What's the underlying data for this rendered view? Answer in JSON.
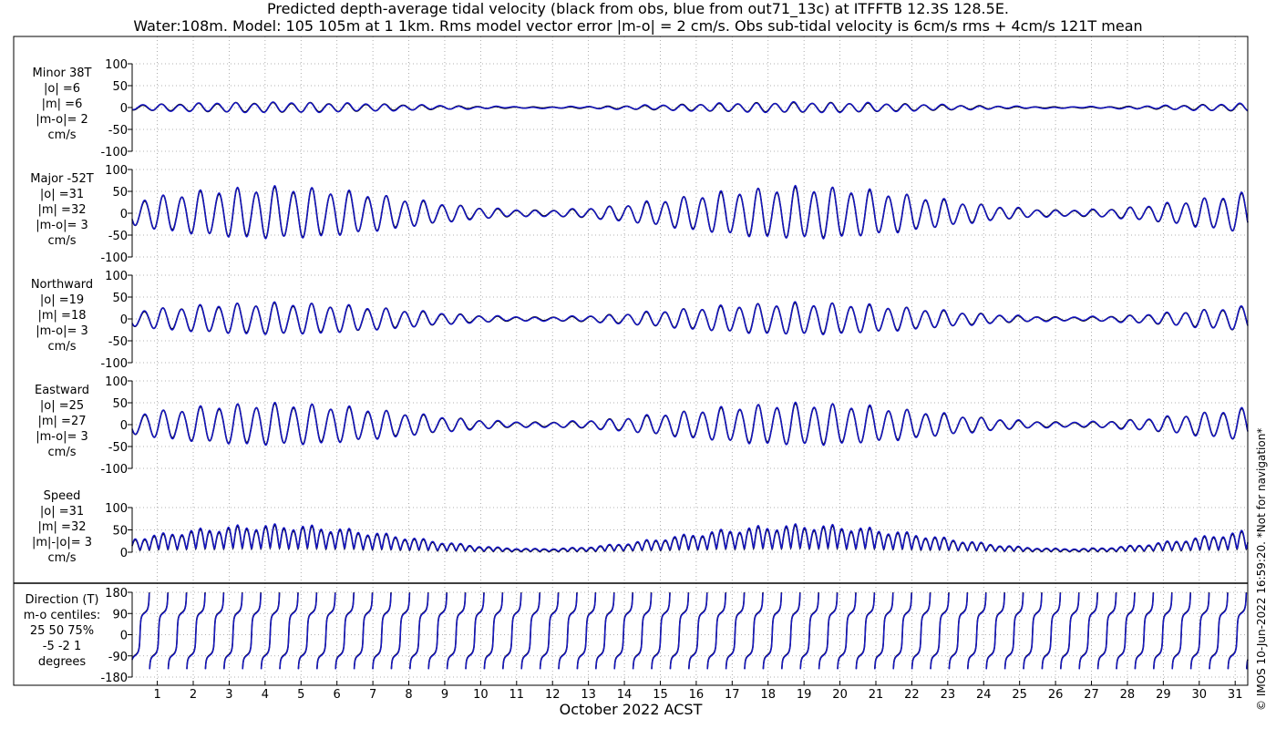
{
  "title": {
    "line1": "Predicted depth-average tidal velocity (black from obs, blue from out71_13c) at ITFFTB 12.3S 128.5E.",
    "line2": "Water:108m. Model: 105 105m at 1 1km. Rms model vector error |m-o| = 2 cm/s. Obs sub-tidal velocity is 6cm/s rms + 4cm/s 121T mean"
  },
  "credit": "© IMOS 10-Jun-2022 16:59:20. *Not for navigation*",
  "xlabel": "October 2022 ACST",
  "colors": {
    "obs": "#000000",
    "model": "#1414c8",
    "grid": "#999999",
    "frame": "#000000"
  },
  "chart_data": {
    "type": "line",
    "x": {
      "label": "October 2022 ACST",
      "ticks": [
        "1",
        "2",
        "3",
        "4",
        "5",
        "6",
        "7",
        "8",
        "9",
        "10",
        "11",
        "12",
        "13",
        "14",
        "15",
        "16",
        "17",
        "18",
        "19",
        "20",
        "21",
        "22",
        "23",
        "24",
        "25",
        "26",
        "27",
        "28",
        "29",
        "30",
        "31"
      ],
      "range_days": [
        0.3,
        31.35
      ]
    },
    "series_legend": [
      "black from obs",
      "blue from out71_13c"
    ],
    "panels": [
      {
        "id": "minor",
        "label": [
          "Minor 38T",
          "|o| =6",
          "|m| =6",
          "|m-o|= 2",
          "cm/s"
        ],
        "ylim": [
          -100,
          100
        ],
        "yticks": [
          100,
          50,
          0,
          -50,
          -100
        ],
        "ytick_labels": [
          "100",
          "50",
          "0",
          "-50",
          "-100"
        ],
        "kind": "component",
        "amp": 6,
        "phase": 0.6
      },
      {
        "id": "major",
        "label": [
          "Major -52T",
          "|o| =31",
          "|m| =32",
          "|m-o|= 3",
          "cm/s"
        ],
        "ylim": [
          -100,
          100
        ],
        "yticks": [
          100,
          50,
          0,
          -50,
          -100
        ],
        "ytick_labels": [
          "100",
          "50",
          "0",
          "-50",
          "-100"
        ],
        "kind": "component",
        "amp": 31,
        "phase": 0
      },
      {
        "id": "northward",
        "label": [
          "Northward",
          "|o| =19",
          "|m| =18",
          "|m-o|= 3",
          "cm/s"
        ],
        "ylim": [
          -100,
          100
        ],
        "yticks": [
          100,
          50,
          0,
          -50,
          -100
        ],
        "ytick_labels": [
          "100",
          "50",
          "0",
          "-50",
          "-100"
        ],
        "kind": "component",
        "amp": 19,
        "phase": 0.1
      },
      {
        "id": "eastward",
        "label": [
          "Eastward",
          "|o| =25",
          "|m| =27",
          "|m-o|= 3",
          "cm/s"
        ],
        "ylim": [
          -100,
          100
        ],
        "yticks": [
          100,
          50,
          0,
          -50,
          -100
        ],
        "ytick_labels": [
          "100",
          "50",
          "0",
          "-50",
          "-100"
        ],
        "kind": "component",
        "amp": 25,
        "phase": -0.05
      },
      {
        "id": "speed",
        "label": [
          "Speed",
          "|o| =31",
          "|m| =32",
          "|m|-|o|= 3",
          "cm/s"
        ],
        "ylim": [
          0,
          100
        ],
        "yticks": [
          100,
          50,
          0
        ],
        "ytick_labels": [
          "100",
          "50",
          "0"
        ],
        "kind": "speed",
        "amp": 31,
        "phase": 0
      },
      {
        "id": "direction",
        "label": [
          "Direction (T)",
          "m-o centiles:",
          "25  50  75%",
          "-5  -2   1",
          "degrees"
        ],
        "ylim": [
          -180,
          180
        ],
        "yticks": [
          180,
          90,
          0,
          -90,
          -180
        ],
        "ytick_labels": [
          "180",
          "90",
          "0",
          "-90",
          "-180"
        ],
        "kind": "direction",
        "amp": 180,
        "phase": 0
      }
    ],
    "tidal_signal": {
      "period_hours": 12.42,
      "spring_neap_days": 14.77,
      "neap_center_day": 19.0,
      "envelope_min": 0.12
    }
  }
}
